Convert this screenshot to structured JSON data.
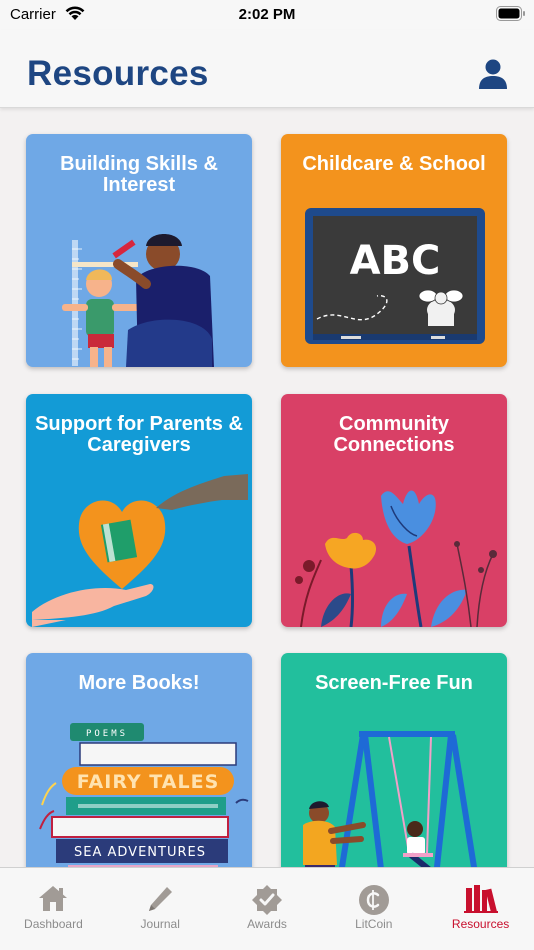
{
  "status_bar": {
    "carrier": "Carrier",
    "time": "2:02 PM"
  },
  "header": {
    "title": "Resources",
    "profile_icon": "person-icon"
  },
  "cards": [
    {
      "label": "Building Skills & Interest",
      "color": "#6fa8e6"
    },
    {
      "label": "Childcare & School",
      "color": "#f3931d",
      "board_text": "ABC"
    },
    {
      "label": "Support for Parents & Caregivers",
      "color": "#139bd6"
    },
    {
      "label": "Community Connections",
      "color": "#d94066"
    },
    {
      "label": "More Books!",
      "color": "#6fa8e6",
      "book_titles": [
        "POEMS",
        "FAIRY TALES",
        "SEA ADVENTURES"
      ]
    },
    {
      "label": "Screen-Free Fun",
      "color": "#22bf9d"
    }
  ],
  "tabs": [
    {
      "label": "Dashboard",
      "icon": "house-icon",
      "active": false
    },
    {
      "label": "Journal",
      "icon": "pencil-icon",
      "active": false
    },
    {
      "label": "Awards",
      "icon": "badge-check-icon",
      "active": false
    },
    {
      "label": "LitCoin",
      "icon": "coin-icon",
      "active": false
    },
    {
      "label": "Resources",
      "icon": "books-icon",
      "active": true
    }
  ],
  "colors": {
    "brand_blue": "#1e4682",
    "active_tab": "#c8102e",
    "inactive_tab": "#8c8c8c"
  }
}
